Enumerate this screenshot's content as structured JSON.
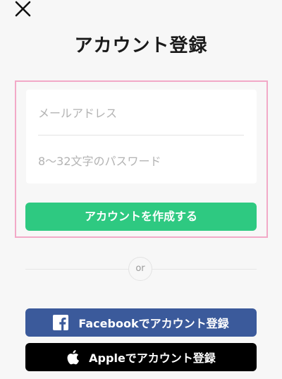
{
  "header": {
    "close_icon": "close-icon",
    "title": "アカウント登録"
  },
  "form": {
    "email_placeholder": "メールアドレス",
    "password_placeholder": "8〜32文字のパスワード",
    "submit_label": "アカウントを作成する",
    "submit_color": "#2ec981",
    "highlight_color": "#f2a9c7"
  },
  "divider": {
    "label": "or"
  },
  "social": {
    "facebook": {
      "label": "Facebookでアカウント登録",
      "icon": "facebook-icon",
      "color": "#3b5a9b"
    },
    "apple": {
      "label": "Appleでアカウント登録",
      "icon": "apple-icon",
      "color": "#000000"
    }
  }
}
